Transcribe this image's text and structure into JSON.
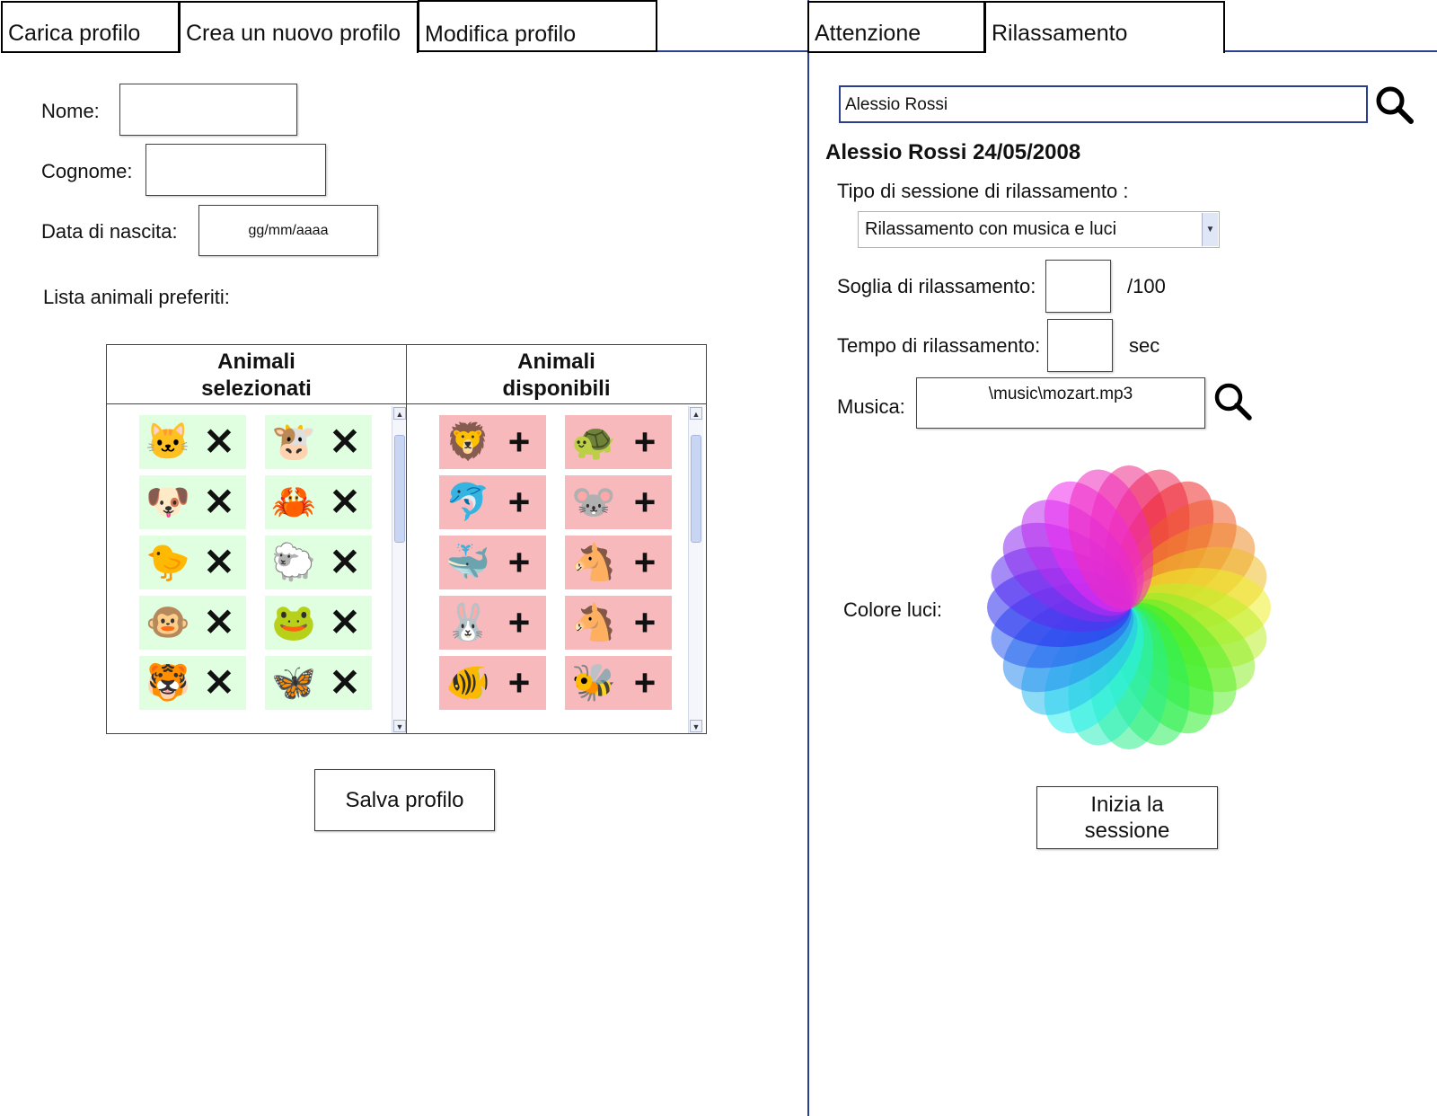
{
  "left_tabs": [
    "Carica profilo",
    "Crea un nuovo profilo",
    "Modifica profilo"
  ],
  "right_tabs": [
    "Attenzione",
    "Rilassamento"
  ],
  "profile_form": {
    "nome_label": "Nome:",
    "cognome_label": "Cognome:",
    "data_label": "Data di nascita:",
    "data_placeholder": "gg/mm/aaaa",
    "lista_label": "Lista animali preferiti:",
    "selected_header": "Animali selezionati",
    "available_header": "Animali disponibili",
    "remove_symbol": "✕",
    "add_symbol": "+",
    "selected_animals": [
      "🐱",
      "🐮",
      "🐶",
      "🦀",
      "🐤",
      "🐑",
      "🐵",
      "🐸",
      "🐯",
      "🦋"
    ],
    "available_animals": [
      "🦁",
      "🐢",
      "🐬",
      "🐭",
      "🐳",
      "🐴",
      "🐰",
      "🐴",
      "🐠",
      "🐝"
    ],
    "save_button": "Salva profilo"
  },
  "relax": {
    "search_value": "Alessio Rossi",
    "patient_title": "Alessio Rossi 24/05/2008",
    "session_type_label": "Tipo di sessione di rilassamento :",
    "session_type_value": "Rilassamento con musica e luci",
    "threshold_label": "Soglia di rilassamento:",
    "threshold_unit": "/100",
    "time_label": "Tempo di rilassamento:",
    "time_unit": "sec",
    "music_label": "Musica:",
    "music_value": "\\music\\mozart.mp3",
    "color_label": "Colore luci:",
    "start_button": "Inizia la sessione"
  },
  "colors": {
    "divider": "#2a3f8f",
    "selected_bg": "#dfffe0",
    "available_bg": "#f8b9bd"
  }
}
